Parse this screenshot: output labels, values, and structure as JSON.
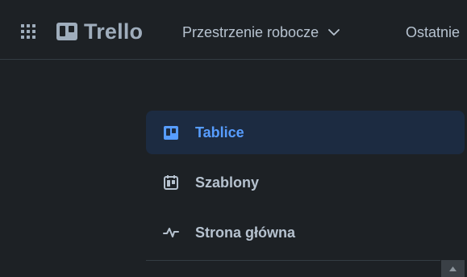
{
  "app": {
    "brand": "Trello",
    "apps_icon": "grid-icon",
    "logo_icon": "trello-board-icon"
  },
  "header": {
    "workspaces_label": "Przestrzenie robocze",
    "workspaces_icon": "chevron-down-icon",
    "recent_label": "Ostatnie"
  },
  "sidebar": {
    "items": [
      {
        "label": "Tablice",
        "icon": "board-icon",
        "active": true
      },
      {
        "label": "Szablony",
        "icon": "template-icon",
        "active": false
      },
      {
        "label": "Strona główna",
        "icon": "activity-icon",
        "active": false
      }
    ]
  },
  "scrollbar": {
    "icon": "scroll-up-arrow-icon"
  },
  "colors": {
    "background": "#1d2125",
    "text": "#b6c2cf",
    "accent": "#579dff",
    "active_bg": "#1c2b41"
  }
}
